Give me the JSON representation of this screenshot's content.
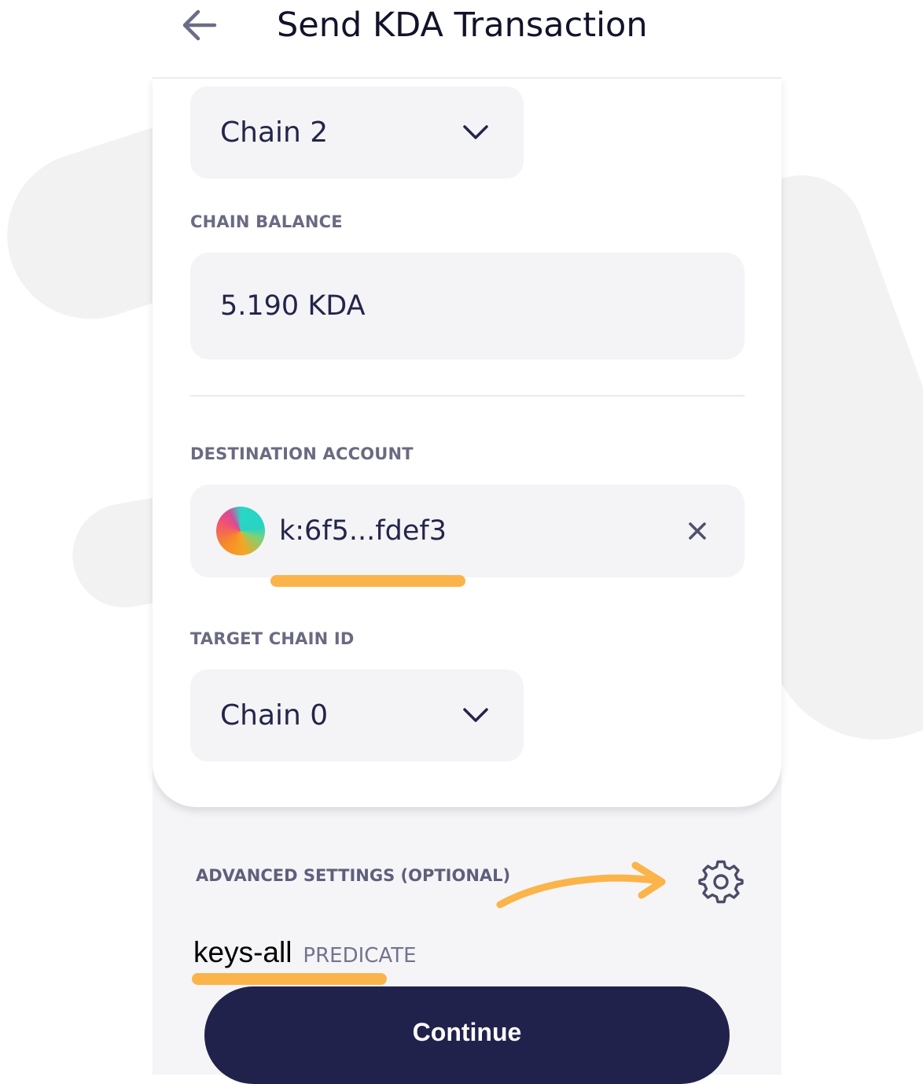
{
  "header": {
    "title": "Send KDA Transaction",
    "back_icon": "arrow-left-icon"
  },
  "source_chain": {
    "selected": "Chain 2"
  },
  "chain_balance": {
    "label": "CHAIN BALANCE",
    "value": "5.190 KDA"
  },
  "destination": {
    "label": "DESTINATION ACCOUNT",
    "account": "k:6f5...fdef3",
    "clear_icon": "close-icon"
  },
  "target_chain": {
    "label": "TARGET CHAIN ID",
    "selected": "Chain 0"
  },
  "advanced": {
    "label": "ADVANCED SETTINGS (OPTIONAL)",
    "settings_icon": "gear-icon"
  },
  "predicate": {
    "value": "keys-all",
    "label": "PREDICATE"
  },
  "continue_label": "Continue",
  "colors": {
    "primary": "#21224c",
    "highlight": "#fbb44a",
    "field_bg": "#f4f4f7",
    "label_gray": "#6a6b82"
  }
}
